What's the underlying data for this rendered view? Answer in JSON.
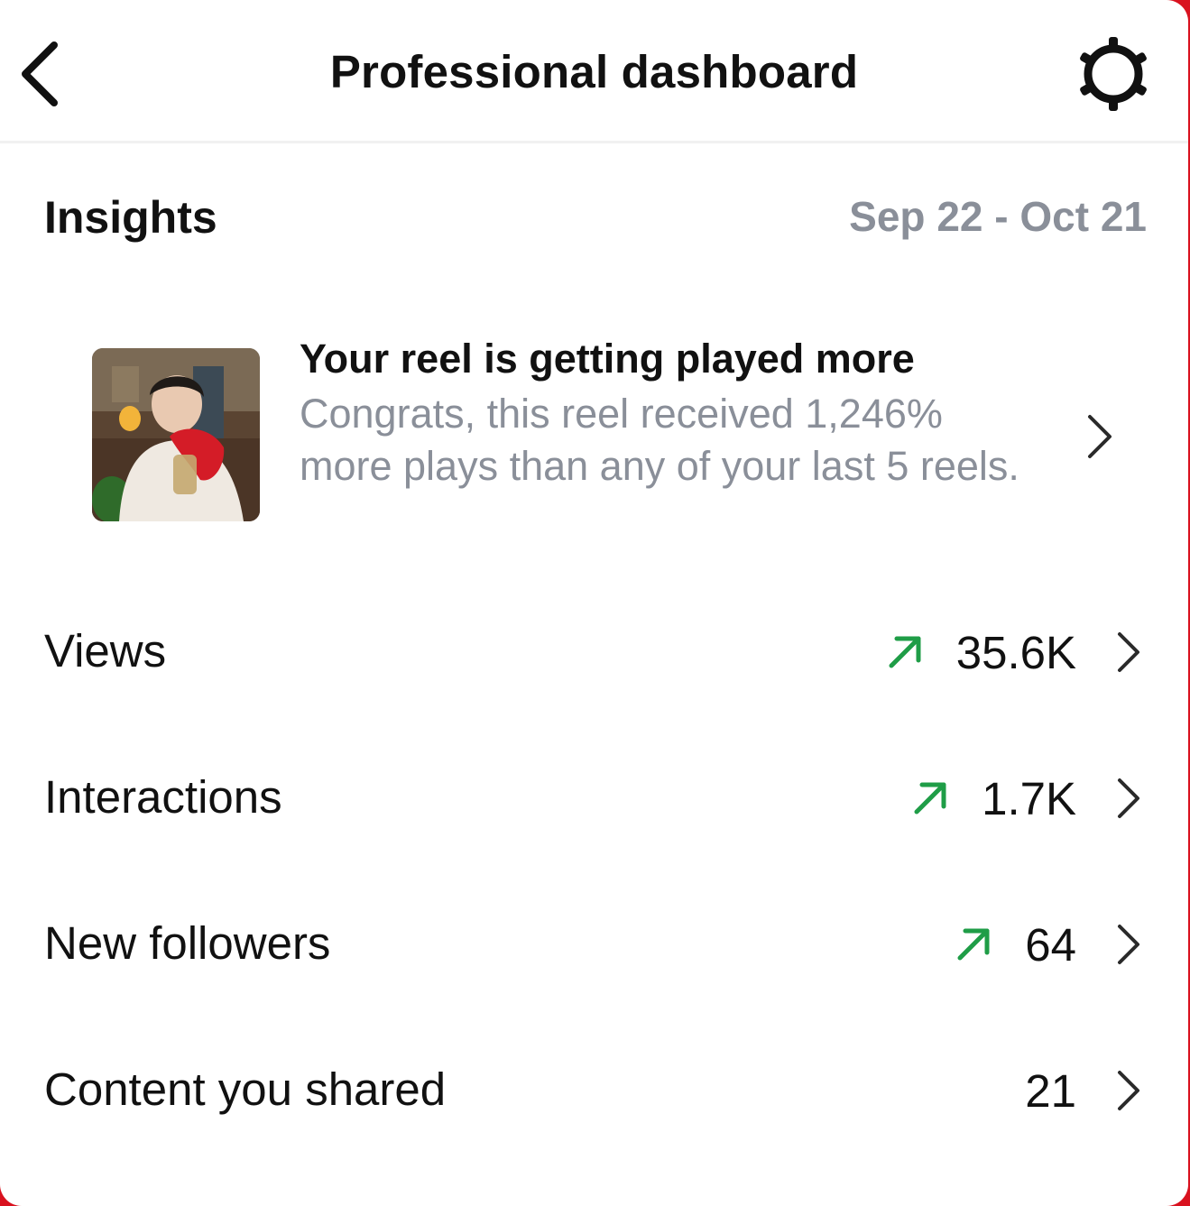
{
  "header": {
    "title": "Professional dashboard",
    "back_icon": "chevron-left-icon",
    "settings_icon": "settings-gear-icon"
  },
  "insights": {
    "title": "Insights",
    "date_range": "Sep 22 - Oct 21"
  },
  "reel_card": {
    "title": "Your reel is getting played more",
    "body": "Congrats, this reel received 1,246% more plays than any of your last 5 reels.",
    "thumbnail": "reel-thumbnail-image",
    "chevron_icon": "chevron-right-icon"
  },
  "metrics": [
    {
      "label": "Views",
      "value": "35.6K",
      "trend": "up"
    },
    {
      "label": "Interactions",
      "value": "1.7K",
      "trend": "up"
    },
    {
      "label": "New followers",
      "value": "64",
      "trend": "up"
    },
    {
      "label": "Content you shared",
      "value": "21",
      "trend": "none"
    }
  ],
  "colors": {
    "trend_up": "#1f9d47",
    "secondary_text": "#8a8f99",
    "frame_border": "#d9121f"
  }
}
